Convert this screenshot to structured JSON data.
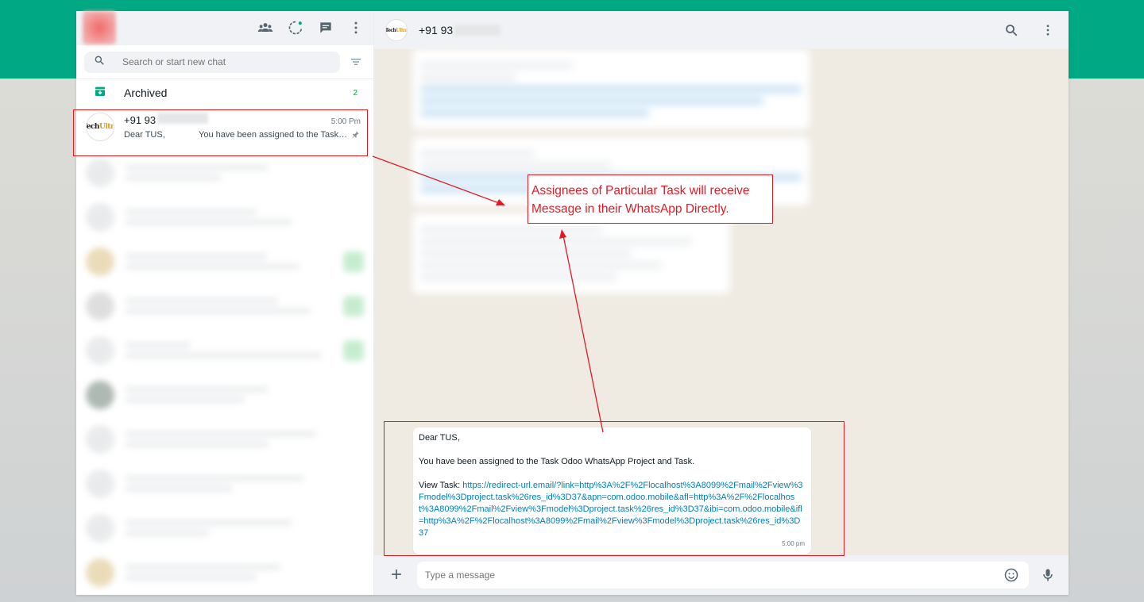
{
  "sidebar": {
    "search_placeholder": "Search or start new chat",
    "archived_label": "Archived",
    "archived_count": "2",
    "icons": [
      "community-icon",
      "status-icon",
      "new-chat-icon",
      "menu-icon",
      "filter-icon",
      "archive-icon"
    ],
    "active_chat": {
      "name": "+91 93",
      "time": "5:00 Pm",
      "preview_greeting": "Dear TUS,",
      "preview_text": "You have been assigned to the Task…",
      "avatar_text_1": "Tech",
      "avatar_text_2": "Ultra"
    }
  },
  "chat": {
    "header_name": "+91 93",
    "message": {
      "line1": "Dear TUS,",
      "line2": "You have been assigned to the Task Odoo WhatsApp Project and Task.",
      "view_label": "View Task: ",
      "link": "https://redirect-url.email/?link=http%3A%2F%2Flocalhost%3A8099%2Fmail%2Fview%3Fmodel%3Dproject.task%26res_id%3D37&apn=com.odoo.mobile&afl=http%3A%2F%2Flocalhost%3A8099%2Fmail%2Fview%3Fmodel%3Dproject.task%26res_id%3D37&ibi=com.odoo.mobile&ifl=http%3A%2F%2Flocalhost%3A8099%2Fmail%2Fview%3Fmodel%3Dproject.task%26res_id%3D37",
      "time": "5:00 pm"
    },
    "composer_placeholder": "Type a message"
  },
  "annotation": {
    "line1": "Assignees of Particular Task will receive",
    "line2": "Message in their WhatsApp Directly.",
    "color": "#e01b24"
  },
  "colors": {
    "accent": "#00a884",
    "link": "#027eb5",
    "unread": "#25d366"
  }
}
